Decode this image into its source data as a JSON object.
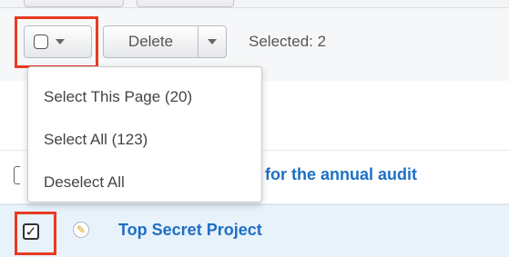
{
  "toolbar": {
    "delete_label": "Delete",
    "selected_text": "Selected: 2"
  },
  "dropdown": {
    "items": [
      {
        "label": "Select This Page (20)"
      },
      {
        "label": "Select All (123)"
      },
      {
        "label": "Deselect All"
      }
    ]
  },
  "rows": [
    {
      "title": "an for the annual audit",
      "checked": false
    },
    {
      "title": "Top Secret Project",
      "checked": true
    }
  ],
  "icons": {
    "checkbox": "checkbox-icon",
    "caret": "caret-down-icon",
    "pencil": "pencil-icon",
    "checkmark": "checkmark-icon"
  },
  "colors": {
    "highlight": "#e83a22",
    "link": "#1f6fc5",
    "selected_row": "#e7f2fb"
  }
}
